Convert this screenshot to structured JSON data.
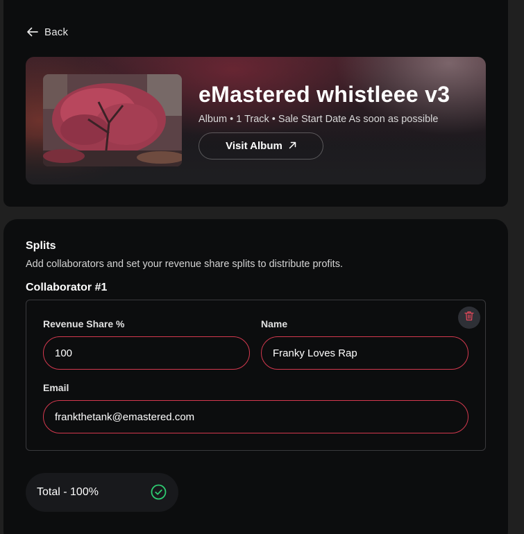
{
  "header": {
    "back_label": "Back"
  },
  "album": {
    "title": "eMastered whistleee v3",
    "meta": "Album • 1 Track • Sale Start Date As soon as possible",
    "visit_label": "Visit Album"
  },
  "splits": {
    "title": "Splits",
    "description": "Add collaborators and set your revenue share splits to distribute profits.",
    "collaborator": {
      "title": "Collaborator #1",
      "revenue_label": "Revenue Share %",
      "revenue_value": "100",
      "name_label": "Name",
      "name_value": "Franky Loves Rap",
      "email_label": "Email",
      "email_value": "frankthetank@emastered.com"
    },
    "total_label": "Total - 100%"
  },
  "icons": {
    "back": "arrow-left-icon",
    "visit": "arrow-up-right-icon",
    "delete": "trash-icon",
    "total_status": "check-circle-icon"
  },
  "colors": {
    "panel_bg": "#0c0d0e",
    "page_bg": "#202020",
    "field_border": "#d5394f",
    "delete_icon": "#e0485a",
    "success": "#2ecc71"
  }
}
